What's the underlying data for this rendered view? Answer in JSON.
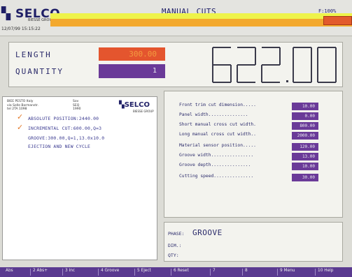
{
  "header": {
    "brand": "SELCO",
    "brand_sub": "BIESSE GROUP",
    "date_text": "12/07/99   15:15:22",
    "title": "MANUAL  CUTS",
    "top_right": "F:100%",
    "colors": {
      "yellow_bar": "#eef34a",
      "orange_bar": "#f3a92e",
      "red_box": "#e25a2c"
    }
  },
  "dimensions": {
    "length_label": "LENGTH",
    "length_value": "300.00",
    "quantity_label": "QUANTITY",
    "quantity_value": "1",
    "big_display": "622.00"
  },
  "program": {
    "head_left": [
      "BIEE PESTO Italy",
      "via Selle Bormanstr.",
      "tel 2TA 1098"
    ],
    "head_mid": [
      "Sov",
      "SEQ",
      "1990"
    ],
    "logo": "SELCO",
    "logo_sub": "BIESSE GROUP",
    "lines": [
      {
        "check": true,
        "text": "ABSOLUTE POSITION:2440.00"
      },
      {
        "check": true,
        "text": "INCREMENTAL CUT:600.00,Q=3"
      },
      {
        "check": false,
        "text": "GROOVE:300.00,Q=1,13.0x10.0"
      },
      {
        "check": false,
        "text": "EJECTION AND NEW CYCLE"
      }
    ]
  },
  "parameters": [
    {
      "label": "Front trim cut dimension.....",
      "value": "10.00"
    },
    {
      "label": "Panel width...............",
      "value": "0.00"
    },
    {
      "label": "Short manual cross cut width.",
      "value": "800.00"
    },
    {
      "label": "Long manual cross cut width..",
      "value": "2000.00"
    },
    {
      "label": "Material sensor position.....",
      "value": "120.00"
    },
    {
      "label": "Groove width................",
      "value": "13.00"
    },
    {
      "label": "Groove depth...............",
      "value": "10.00"
    },
    {
      "label": "Cutting speed...............",
      "value": "30.00"
    }
  ],
  "phase": {
    "phase_label": "PHASE:",
    "phase_value": "GROOVE",
    "dim_label": "DIM.:",
    "qty_label": "QTY:"
  },
  "function_keys": [
    "Abs",
    "2  Abs+",
    "3    Inc",
    "4 Groove",
    "5 Eject",
    "6 Reset",
    "7",
    "8",
    "9  Menu",
    "10 Help"
  ]
}
